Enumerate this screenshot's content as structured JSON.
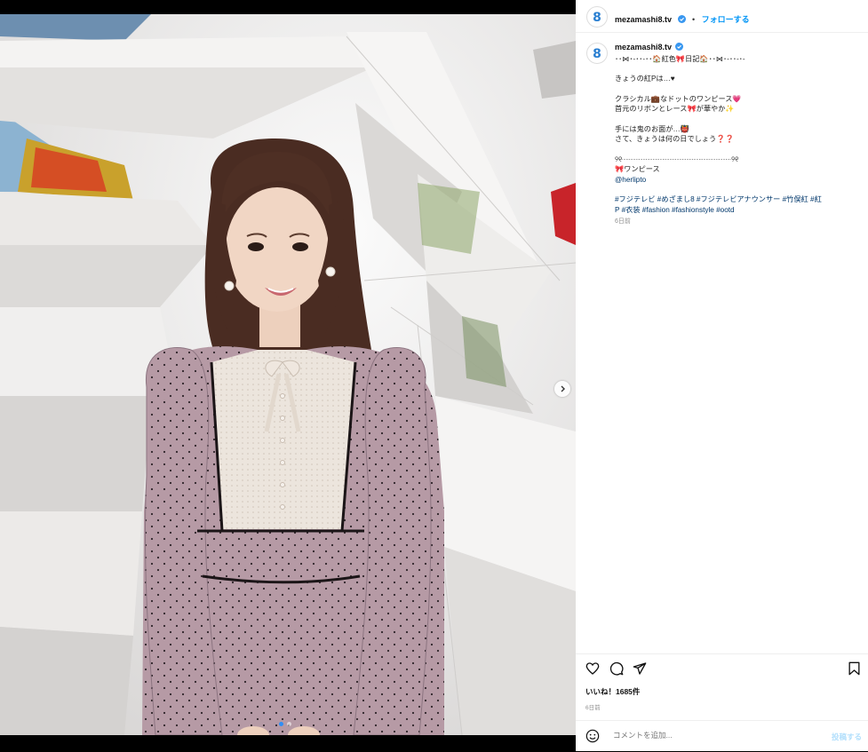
{
  "post": {
    "username": "mezamashi8.tv",
    "follow_label": "フォローする",
    "separator": "•"
  },
  "caption": {
    "username": "mezamashi8.tv",
    "lines": [
      "･･⋈･-･･-･･🏠紅色🎀日記🏠･･⋈･-･･-･-",
      "",
      "きょうの紅Pは…♥",
      "",
      "クラシカル💼なドットのワンピース💗",
      "首元のリボンとレース🎀が華やか✨",
      "",
      "手には鬼のお面が…👹",
      "さて、きょうは何の日でしょう❓❓",
      "",
      "୨୧┈┈┈┈┈┈┈┈┈┈┈┈┈┈┈୨୧",
      "🎀ワンピース"
    ],
    "mention": "@herlipto",
    "hashtags_line1": "#フジテレビ #めざまし8 #フジテレビアナウンサー #竹俣紅 #紅",
    "hashtags_line2": "P #衣装 #fashion #fashionstyle #ootd",
    "age": "6日前"
  },
  "engagement": {
    "likes": "いいね！1685件",
    "time": "6日前"
  },
  "comment": {
    "placeholder": "コメントを追加...",
    "post_label": "投稿する"
  },
  "icons": {
    "like": "heart-icon",
    "comment": "comment-icon",
    "share": "share-icon",
    "save": "bookmark-icon",
    "emoji": "smiley-icon",
    "next": "chevron-right-icon",
    "verified": "verified-badge-icon"
  },
  "carousel": {
    "total": 2,
    "current": 1
  },
  "colors": {
    "accent": "#0095f6",
    "verified": "#3897f0",
    "tag": "#00376b",
    "muted": "#8e8e8e"
  }
}
